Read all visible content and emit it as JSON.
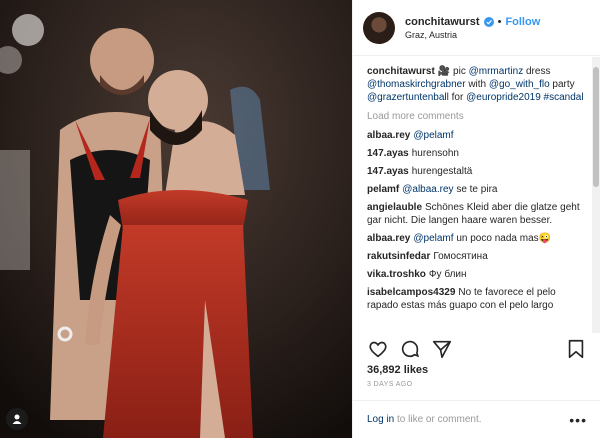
{
  "post": {
    "username": "conchitawurst",
    "follow_label": "Follow",
    "dot": "•",
    "location": "Graz, Austria",
    "caption": {
      "username": "conchitawurst",
      "text": "🎥 pic @mrmartinz dress @thomaskirchgrabner with @go_with_flo party @grazertuntenball for @europride2019 #scandal"
    },
    "load_more": "Load more comments",
    "comments": [
      {
        "username": "albaa.rey",
        "text": "@pelamf"
      },
      {
        "username": "147.ayas",
        "text": "hurensohn"
      },
      {
        "username": "147.ayas",
        "text": "hurengestaltä"
      },
      {
        "username": "pelamf",
        "text": "@albaa.rey se te pira"
      },
      {
        "username": "angielauble",
        "text": "Schönes Kleid aber die glatze geht gar nicht. Die langen haare waren besser."
      },
      {
        "username": "albaa.rey",
        "text": "@pelamf un poco nada mas😜"
      },
      {
        "username": "rakutsinfedar",
        "text": "Гомосятина"
      },
      {
        "username": "vika.troshko",
        "text": "Фу блин"
      },
      {
        "username": "isabelcampos4329",
        "text": "No te favorece el pelo rapado estas más guapo con el pelo largo"
      }
    ],
    "likes": "36,892 likes",
    "date": "3 DAYS AGO",
    "login_link": "Log in",
    "login_text": " to like or comment.",
    "options": "•••",
    "icons": {
      "heart": "heart-icon",
      "comment": "comment-icon",
      "share": "share-icon",
      "save": "bookmark-icon",
      "verified": "verified-badge-icon"
    },
    "colors": {
      "accent": "#3897f0",
      "link": "#003569",
      "muted": "#999999",
      "dress": "#b23222"
    }
  }
}
